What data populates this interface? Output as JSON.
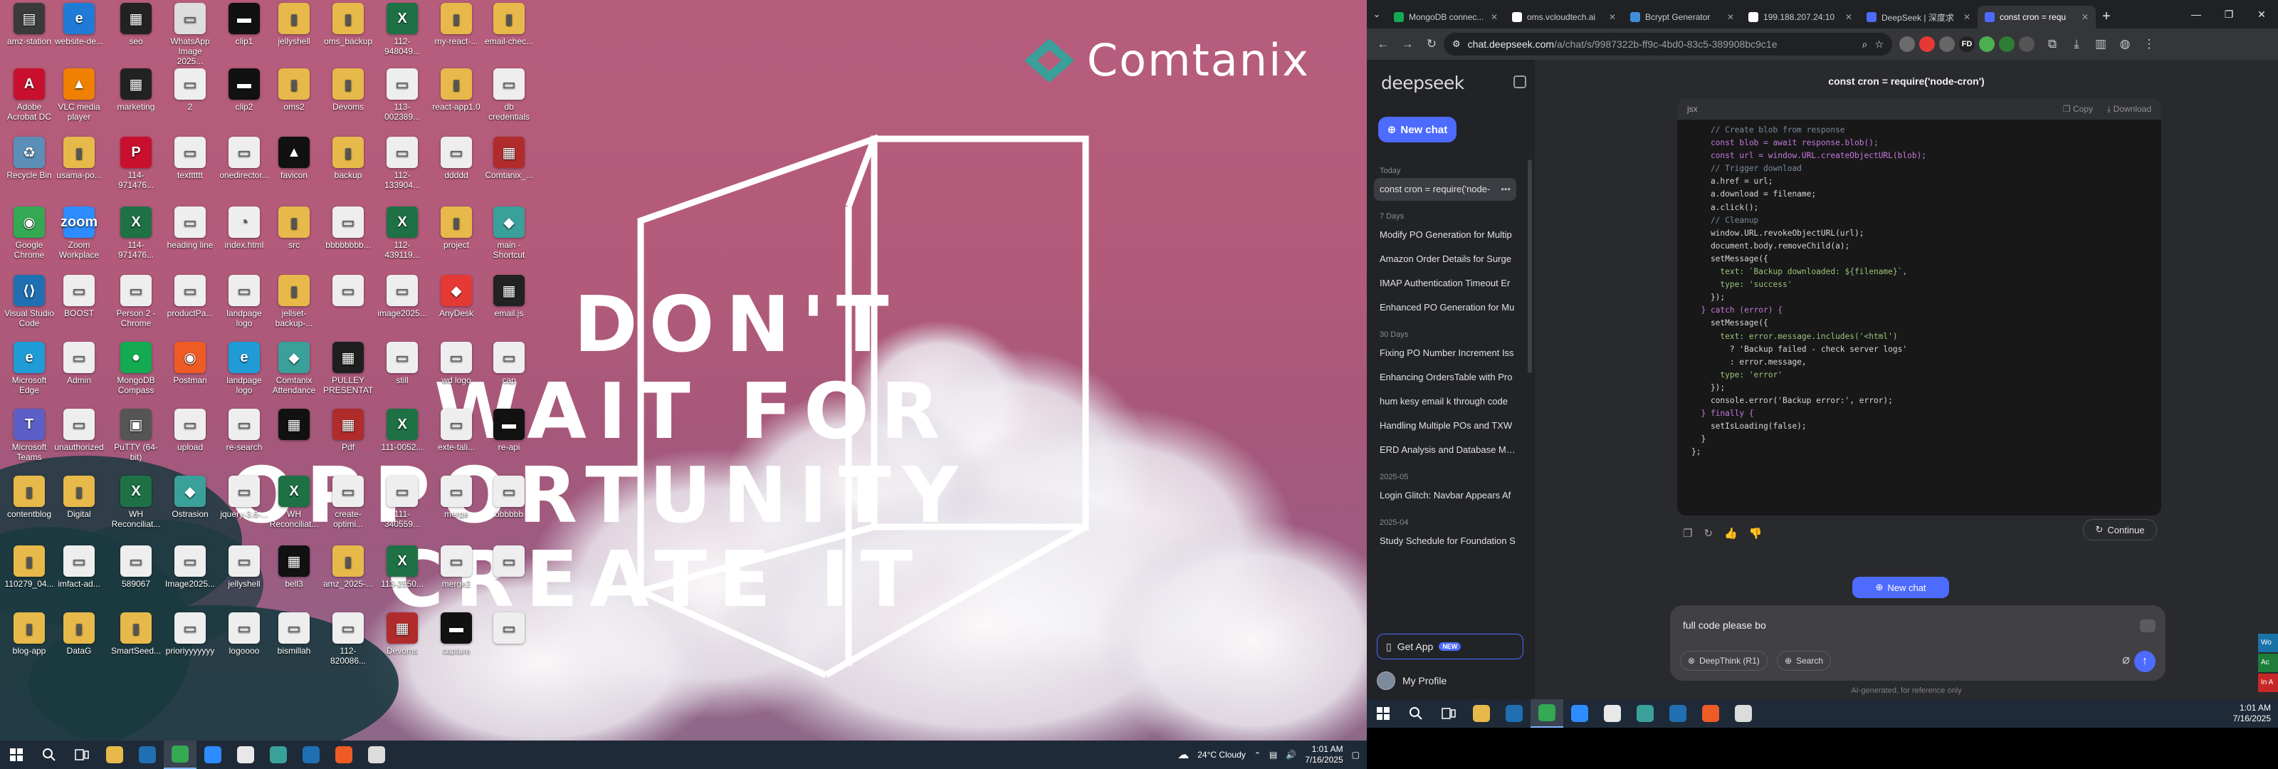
{
  "wallpaper": {
    "brand": "Comtanix",
    "quote": [
      "DON'T",
      "WAIT FOR",
      "OPPORTUNITY",
      "CREATE IT"
    ]
  },
  "desktop_icons": [
    {
      "label": "amz-station",
      "color": "#3a3a3a",
      "glyph": "▤"
    },
    {
      "label": "website-de...",
      "color": "#1f7bd6",
      "glyph": "e"
    },
    {
      "label": "seo",
      "color": "#222",
      "glyph": "▦"
    },
    {
      "label": "WhatsApp Image 2025...",
      "color": "#ddd",
      "glyph": "▭"
    },
    {
      "label": "clip1",
      "color": "#111",
      "glyph": "▬"
    },
    {
      "label": "jellyshell",
      "color": "#e7b94a",
      "glyph": "▮"
    },
    {
      "label": "oms_backup",
      "color": "#e7b94a",
      "glyph": "▮"
    },
    {
      "label": "112-948049...",
      "color": "#1e7145",
      "glyph": "X"
    },
    {
      "label": "my-react-...",
      "color": "#e7b94a",
      "glyph": "▮"
    },
    {
      "label": "email-chec...",
      "color": "#e7b94a",
      "glyph": "▮"
    },
    {
      "label": "Adobe Acrobat DC",
      "color": "#c8102e",
      "glyph": "A"
    },
    {
      "label": "VLC media player",
      "color": "#f08000",
      "glyph": "▲"
    },
    {
      "label": "marketing",
      "color": "#222",
      "glyph": "▦"
    },
    {
      "label": "2",
      "color": "#eee",
      "glyph": "▭"
    },
    {
      "label": "clip2",
      "color": "#111",
      "glyph": "▬"
    },
    {
      "label": "oms2",
      "color": "#e7b94a",
      "glyph": "▮"
    },
    {
      "label": "Devoms",
      "color": "#e7b94a",
      "glyph": "▮"
    },
    {
      "label": "113-002389...",
      "color": "#eee",
      "glyph": "▭"
    },
    {
      "label": "react-app1.0",
      "color": "#e7b94a",
      "glyph": "▮"
    },
    {
      "label": "db credentials",
      "color": "#eee",
      "glyph": "▭"
    },
    {
      "label": "Recycle Bin",
      "color": "#5c8fb8",
      "glyph": "♻"
    },
    {
      "label": "usama-po...",
      "color": "#e7b94a",
      "glyph": "▮"
    },
    {
      "label": "114-971476...",
      "color": "#c8102e",
      "glyph": "P"
    },
    {
      "label": "textttttt",
      "color": "#eee",
      "glyph": "▭"
    },
    {
      "label": "onedirector...",
      "color": "#eee",
      "glyph": "▭"
    },
    {
      "label": "favicon",
      "color": "#111",
      "glyph": "▲"
    },
    {
      "label": "backup",
      "color": "#e7b94a",
      "glyph": "▮"
    },
    {
      "label": "112-133904...",
      "color": "#eee",
      "glyph": "▭"
    },
    {
      "label": "ddddd",
      "color": "#eee",
      "glyph": "▭"
    },
    {
      "label": "Comtanix_...",
      "color": "#b02c2c",
      "glyph": "▦"
    },
    {
      "label": "Google Chrome",
      "color": "#34a853",
      "glyph": "◉"
    },
    {
      "label": "Zoom Workplace",
      "color": "#2d8cff",
      "glyph": "zoom"
    },
    {
      "label": "114-971476...",
      "color": "#1e7145",
      "glyph": "X"
    },
    {
      "label": "heading line",
      "color": "#eee",
      "glyph": "▭"
    },
    {
      "label": "index.html",
      "color": "#eee",
      "glyph": "◔"
    },
    {
      "label": "src",
      "color": "#e7b94a",
      "glyph": "▮"
    },
    {
      "label": "bbbbbbbb...",
      "color": "#eee",
      "glyph": "▭"
    },
    {
      "label": "112-439119...",
      "color": "#1e7145",
      "glyph": "X"
    },
    {
      "label": "project",
      "color": "#e7b94a",
      "glyph": "▮"
    },
    {
      "label": "main - Shortcut",
      "color": "#3aa09a",
      "glyph": "◆"
    },
    {
      "label": "Visual Studio Code",
      "color": "#1f6fb2",
      "glyph": "⟨⟩"
    },
    {
      "label": "BOOST",
      "color": "#eee",
      "glyph": "▭"
    },
    {
      "label": "Person 2 - Chrome",
      "color": "#eee",
      "glyph": "▭"
    },
    {
      "label": "productPa...",
      "color": "#eee",
      "glyph": "▭"
    },
    {
      "label": "landpage logo",
      "color": "#eee",
      "glyph": "▭"
    },
    {
      "label": "jellset-backup-...",
      "color": "#e7b94a",
      "glyph": "▮"
    },
    {
      "label": "",
      "color": "#eee",
      "glyph": "▭"
    },
    {
      "label": "image2025...",
      "color": "#eee",
      "glyph": "▭"
    },
    {
      "label": "AnyDesk",
      "color": "#e53935",
      "glyph": "◆"
    },
    {
      "label": "email.js",
      "color": "#222",
      "glyph": "▦"
    },
    {
      "label": "Microsoft Edge",
      "color": "#1f9bd6",
      "glyph": "e"
    },
    {
      "label": "Admin",
      "color": "#eee",
      "glyph": "▭"
    },
    {
      "label": "MongoDB Compass",
      "color": "#13aa52",
      "glyph": "●"
    },
    {
      "label": "Postman",
      "color": "#ef5b25",
      "glyph": "◉"
    },
    {
      "label": "landpage logo",
      "color": "#1f9bd6",
      "glyph": "e"
    },
    {
      "label": "Comtanix Attendance",
      "color": "#3aa09a",
      "glyph": "◆"
    },
    {
      "label": "PULLEY PRESENTATI...",
      "color": "#1e1e1e",
      "glyph": "▦"
    },
    {
      "label": "still",
      "color": "#eee",
      "glyph": "▭"
    },
    {
      "label": "wd logo",
      "color": "#eee",
      "glyph": "▭"
    },
    {
      "label": "cap",
      "color": "#eee",
      "glyph": "▭"
    },
    {
      "label": "Microsoft Teams",
      "color": "#5b5fc7",
      "glyph": "T"
    },
    {
      "label": "unauthorized",
      "color": "#eee",
      "glyph": "▭"
    },
    {
      "label": "PuTTY (64-bit)",
      "color": "#555",
      "glyph": "▣"
    },
    {
      "label": "upload",
      "color": "#eee",
      "glyph": "▭"
    },
    {
      "label": "re-search",
      "color": "#eee",
      "glyph": "▭"
    },
    {
      "label": "",
      "color": "#111",
      "glyph": "▦"
    },
    {
      "label": "Pdf",
      "color": "#b02c2c",
      "glyph": "▦"
    },
    {
      "label": "111-0052...",
      "color": "#1e7145",
      "glyph": "X"
    },
    {
      "label": "exte-tali...",
      "color": "#eee",
      "glyph": "▭"
    },
    {
      "label": "re-api",
      "color": "#111",
      "glyph": "▬"
    },
    {
      "label": "contentblog",
      "color": "#e7b94a",
      "glyph": "▮"
    },
    {
      "label": "Digital",
      "color": "#e7b94a",
      "glyph": "▮"
    },
    {
      "label": "WH Reconciliat...",
      "color": "#1e7145",
      "glyph": "X"
    },
    {
      "label": "Ostrasion",
      "color": "#3aa09a",
      "glyph": "◆"
    },
    {
      "label": "jquery-3.6-...",
      "color": "#eee",
      "glyph": "▭"
    },
    {
      "label": "WH Reconciliat...",
      "color": "#1e7145",
      "glyph": "X"
    },
    {
      "label": "create-optimi...",
      "color": "#eee",
      "glyph": "▭"
    },
    {
      "label": "111-340559...",
      "color": "#eee",
      "glyph": "▭"
    },
    {
      "label": "merge",
      "color": "#eee",
      "glyph": "▭"
    },
    {
      "label": "bbbbbb",
      "color": "#eee",
      "glyph": "▭"
    },
    {
      "label": "110279_04...",
      "color": "#e7b94a",
      "glyph": "▮"
    },
    {
      "label": "imfact-ad...",
      "color": "#eee",
      "glyph": "▭"
    },
    {
      "label": "589067",
      "color": "#eee",
      "glyph": "▭"
    },
    {
      "label": "Image2025...",
      "color": "#eee",
      "glyph": "▭"
    },
    {
      "label": "jellyshell",
      "color": "#eee",
      "glyph": "▭"
    },
    {
      "label": "bell3",
      "color": "#111",
      "glyph": "▦"
    },
    {
      "label": "amz_2025-...",
      "color": "#e7b94a",
      "glyph": "▮"
    },
    {
      "label": "113-2550...",
      "color": "#1e7145",
      "glyph": "X"
    },
    {
      "label": "merge2",
      "color": "#eee",
      "glyph": "▭"
    },
    {
      "label": "",
      "color": "#eee",
      "glyph": "▭"
    },
    {
      "label": "blog-app",
      "color": "#e7b94a",
      "glyph": "▮"
    },
    {
      "label": "DataG",
      "color": "#e7b94a",
      "glyph": "▮"
    },
    {
      "label": "SmartSeed...",
      "color": "#e7b94a",
      "glyph": "▮"
    },
    {
      "label": "prioriyyyyyyy",
      "color": "#eee",
      "glyph": "▭"
    },
    {
      "label": "logoooo",
      "color": "#eee",
      "glyph": "▭"
    },
    {
      "label": "bismillah",
      "color": "#eee",
      "glyph": "▭"
    },
    {
      "label": "112-820086...",
      "color": "#eee",
      "glyph": "▭"
    },
    {
      "label": "Devoms",
      "color": "#b02c2c",
      "glyph": "▦"
    },
    {
      "label": "capture",
      "color": "#111",
      "glyph": "▬"
    },
    {
      "label": "",
      "color": "#eee",
      "glyph": "▭"
    }
  ],
  "left_taskbar": {
    "weather": "24°C  Cloudy",
    "time": "1:01 AM",
    "date": "7/16/2025",
    "apps": [
      {
        "name": "file-explorer",
        "color": "#e7b94a"
      },
      {
        "name": "store",
        "color": "#1f6fb2"
      },
      {
        "name": "chrome",
        "color": "#34a853"
      },
      {
        "name": "zoom",
        "color": "#2d8cff"
      },
      {
        "name": "anydesk",
        "color": "#e8e8e8"
      },
      {
        "name": "comtanix",
        "color": "#3aa09a"
      },
      {
        "name": "vscode",
        "color": "#1f6fb2"
      },
      {
        "name": "postman",
        "color": "#ef5b25"
      },
      {
        "name": "puppet",
        "color": "#dcdcdc"
      }
    ]
  },
  "browser": {
    "tabs": [
      {
        "title": "MongoDB connec...",
        "fav": "#13aa52"
      },
      {
        "title": "oms.vcloudtech.ai",
        "fav": "#ffffff"
      },
      {
        "title": "Bcrypt Generator",
        "fav": "#3f8fdd"
      },
      {
        "title": "199.188.207.24:10",
        "fav": "#ffffff"
      },
      {
        "title": "DeepSeek | 深度求",
        "fav": "#4d6bfe"
      },
      {
        "title": "const cron = requ",
        "fav": "#4d6bfe",
        "active": true
      }
    ],
    "url_host": "chat.deepseek.com",
    "url_path": "/a/chat/s/9987322b-ff9c-4bd0-83c5-389908bc9c1e",
    "extensions": [
      {
        "label": "",
        "color": "#6b6b6b"
      },
      {
        "label": "",
        "color": "#e53935"
      },
      {
        "label": "",
        "color": "#666"
      },
      {
        "label": "FD",
        "color": "#222"
      },
      {
        "label": "",
        "color": "#4caf50"
      },
      {
        "label": "",
        "color": "#2e7d32"
      },
      {
        "label": "",
        "color": "#555"
      }
    ]
  },
  "deepseek": {
    "logo": "deepseek",
    "new_chat": "New chat",
    "sections": [
      {
        "label": "Today",
        "items": [
          {
            "t": "const cron = require('node-",
            "sel": true
          }
        ]
      },
      {
        "label": "7 Days",
        "items": [
          {
            "t": "Modify PO Generation for Multip"
          },
          {
            "t": "Amazon Order Details for Surge"
          },
          {
            "t": "IMAP Authentication Timeout Er"
          },
          {
            "t": "Enhanced PO Generation for Mu"
          }
        ]
      },
      {
        "label": "30 Days",
        "items": [
          {
            "t": "Fixing PO Number Increment Iss"
          },
          {
            "t": "Enhancing OrdersTable with Pro"
          },
          {
            "t": "hum kesy email k through code"
          },
          {
            "t": "Handling Multiple POs and TXW"
          },
          {
            "t": "ERD Analysis and Database Mod"
          }
        ]
      },
      {
        "label": "2025-05",
        "items": [
          {
            "t": "Login Glitch: Navbar Appears Af"
          }
        ]
      },
      {
        "label": "2025-04",
        "items": [
          {
            "t": "Study Schedule for Foundation S"
          }
        ]
      }
    ],
    "get_app": "Get App",
    "get_app_badge": "NEW",
    "profile": "My Profile",
    "chat_title": "const cron = require('node-cron')",
    "code_lang": "jsx",
    "copy_label": "Copy",
    "download_label": "Download",
    "code_lines": [
      "    // Create blob from response",
      "    const blob = await response.blob();",
      "    const url = window.URL.createObjectURL(blob);",
      "",
      "    // Trigger download",
      "    a.href = url;",
      "    a.download = filename;",
      "    a.click();",
      "",
      "    // Cleanup",
      "    window.URL.revokeObjectURL(url);",
      "    document.body.removeChild(a);",
      "",
      "    setMessage({",
      "      text: `Backup downloaded: ${filename}`,",
      "      type: 'success'",
      "    });",
      "",
      "  } catch (error) {",
      "    setMessage({",
      "      text: error.message.includes('<html')",
      "        ? 'Backup failed - check server logs'",
      "        : error.message,",
      "      type: 'error'",
      "    });",
      "    console.error('Backup error:', error);",
      "  } finally {",
      "    setIsLoading(false);",
      "  }",
      "};"
    ],
    "continue_label": "Continue",
    "new_chat_float": "New chat",
    "composer_text": "full code please bo",
    "deepthink_label": "DeepThink (R1)",
    "search_label": "Search",
    "footnote": "AI-generated, for reference only",
    "side_badges": [
      {
        "label": "Wo",
        "color": "#1a73a8"
      },
      {
        "label": "Ac",
        "color": "#1e7d3b"
      },
      {
        "label": "In A",
        "color": "#c62828"
      }
    ]
  },
  "right_taskbar": {
    "time": "1:01 AM",
    "date": "7/16/2025",
    "apps": [
      {
        "name": "file-explorer",
        "color": "#e7b94a"
      },
      {
        "name": "store",
        "color": "#1f6fb2"
      },
      {
        "name": "chrome",
        "color": "#34a853"
      },
      {
        "name": "zoom",
        "color": "#2d8cff"
      },
      {
        "name": "anydesk",
        "color": "#e8e8e8"
      },
      {
        "name": "comtanix",
        "color": "#3aa09a"
      },
      {
        "name": "vscode",
        "color": "#1f6fb2"
      },
      {
        "name": "postman",
        "color": "#ef5b25"
      },
      {
        "name": "puppet",
        "color": "#dcdcdc"
      }
    ]
  }
}
